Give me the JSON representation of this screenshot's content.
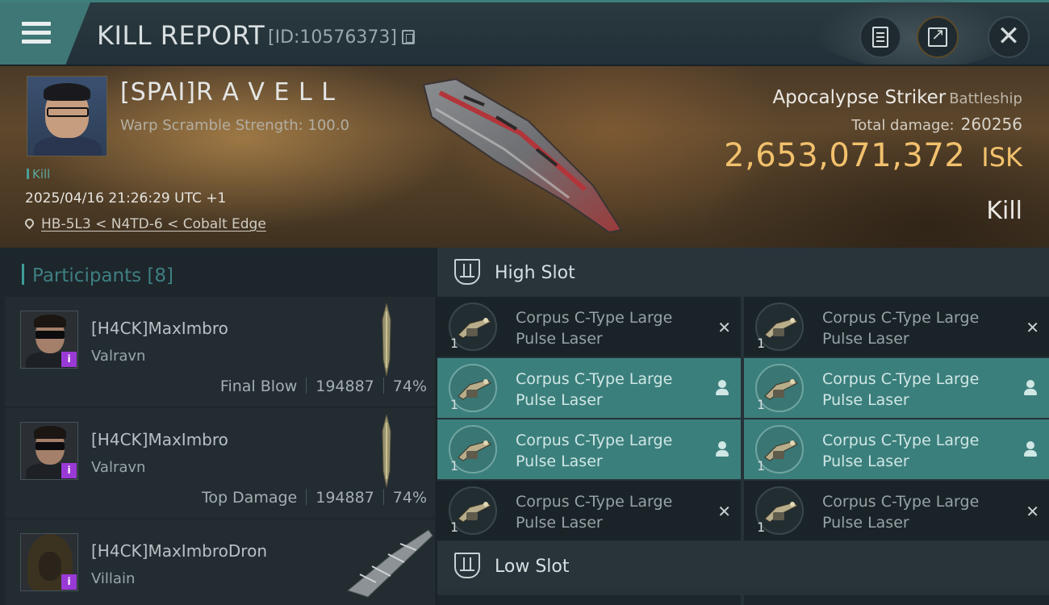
{
  "header": {
    "title": "KILL REPORT",
    "report_id": "[ID:10576373]",
    "icons": [
      "menu-icon",
      "copy-icon",
      "document-icon",
      "share-icon",
      "close-icon"
    ]
  },
  "victim": {
    "name": "[SPAI]R A V E L L",
    "warp_scramble": "Warp Scramble Strength: 100.0",
    "tag": "Kill",
    "timestamp": "2025/04/16 21:26:29 UTC +1",
    "location": "HB-5L3 < N4TD-6 < Cobalt Edge",
    "ship_name": "Apocalypse Striker",
    "ship_class": "Battleship",
    "total_damage_label": "Total damage:",
    "total_damage": "260256",
    "isk_value": "2,653,071,372",
    "isk_unit": "ISK",
    "result": "Kill"
  },
  "participants": {
    "header": "Participants [8]",
    "rows": [
      {
        "name": "[H4CK]MaxImbro",
        "ship": "Valravn",
        "role": "Final Blow",
        "damage": "194887",
        "percent": "74%",
        "badge": "i"
      },
      {
        "name": "[H4CK]MaxImbro",
        "ship": "Valravn",
        "role": "Top Damage",
        "damage": "194887",
        "percent": "74%",
        "badge": "i"
      },
      {
        "name": "[H4CK]MaxImbroDron",
        "ship": "Villain",
        "badge": "i"
      }
    ]
  },
  "modules": {
    "high_slot_title": "High Slot",
    "low_slot_title": "Low Slot",
    "high_slot": [
      {
        "name": "Corpus C-Type Large Pulse Laser",
        "qty": "1",
        "state": "destroyed",
        "mark": "✕"
      },
      {
        "name": "Corpus C-Type Large Pulse Laser",
        "qty": "1",
        "state": "destroyed",
        "mark": "✕"
      },
      {
        "name": "Corpus C-Type Large Pulse Laser",
        "qty": "1",
        "state": "dropped"
      },
      {
        "name": "Corpus C-Type Large Pulse Laser",
        "qty": "1",
        "state": "dropped"
      },
      {
        "name": "Corpus C-Type Large Pulse Laser",
        "qty": "1",
        "state": "dropped"
      },
      {
        "name": "Corpus C-Type Large Pulse Laser",
        "qty": "1",
        "state": "dropped"
      },
      {
        "name": "Corpus C-Type Large Pulse Laser",
        "qty": "1",
        "state": "destroyed",
        "mark": "✕"
      },
      {
        "name": "Corpus C-Type Large Pulse Laser",
        "qty": "1",
        "state": "destroyed",
        "mark": "✕"
      }
    ]
  },
  "colors": {
    "accent_teal": "#3e7f7d",
    "isk_gold": "#f2c16d",
    "dropped_row": "#3b7f7c",
    "badge_purple": "#9a3ad6"
  }
}
